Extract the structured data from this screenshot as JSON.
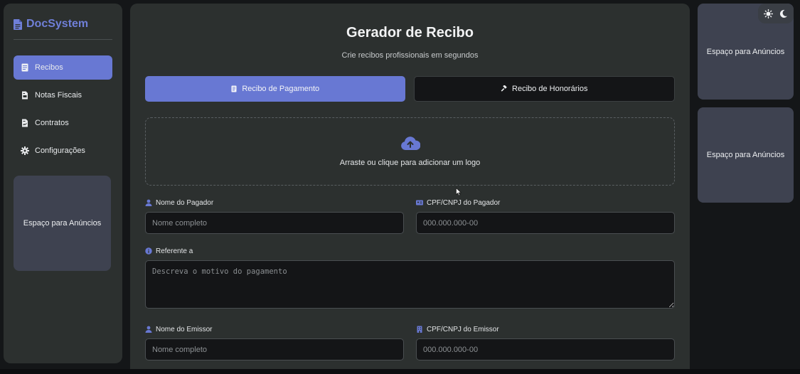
{
  "brand": {
    "name": "DocSystem",
    "color": "#6f7fd8"
  },
  "nav": {
    "items": [
      {
        "label": "Recibos",
        "icon": "receipt-icon",
        "active": true
      },
      {
        "label": "Notas Fiscais",
        "icon": "file-invoice-icon",
        "active": false
      },
      {
        "label": "Contratos",
        "icon": "file-contract-icon",
        "active": false
      },
      {
        "label": "Configurações",
        "icon": "gear-icon",
        "active": false
      }
    ]
  },
  "ads": {
    "sidebar": "Espaço para Anúncios",
    "right_top": "Espaço para Anúncios",
    "right_bottom": "Espaço para Anúncios"
  },
  "header": {
    "title": "Gerador de Recibo",
    "subtitle": "Crie recibos profissionais em segundos"
  },
  "tabs": [
    {
      "label": "Recibo de Pagamento",
      "icon": "receipt-icon",
      "active": true
    },
    {
      "label": "Recibo de Honorários",
      "icon": "gavel-icon",
      "active": false
    }
  ],
  "upload": {
    "text": "Arraste ou clique para adicionar um logo",
    "icon": "cloud-upload-icon"
  },
  "form": {
    "payer_name": {
      "label": "Nome do Pagador",
      "placeholder": "Nome completo"
    },
    "payer_doc": {
      "label": "CPF/CNPJ do Pagador",
      "placeholder": "000.000.000-00"
    },
    "reference": {
      "label": "Referente a",
      "placeholder": "Descreva o motivo do pagamento"
    },
    "issuer_name": {
      "label": "Nome do Emissor",
      "placeholder": "Nome completo"
    },
    "issuer_doc": {
      "label": "CPF/CNPJ do Emissor",
      "placeholder": "000.000.000-00"
    }
  },
  "theme": {
    "light_icon": "sun-icon",
    "dark_icon": "moon-icon"
  },
  "colors": {
    "accent": "#6878d3",
    "panel": "#2c302f",
    "background": "#141618",
    "ad_box": "#3e4250"
  }
}
